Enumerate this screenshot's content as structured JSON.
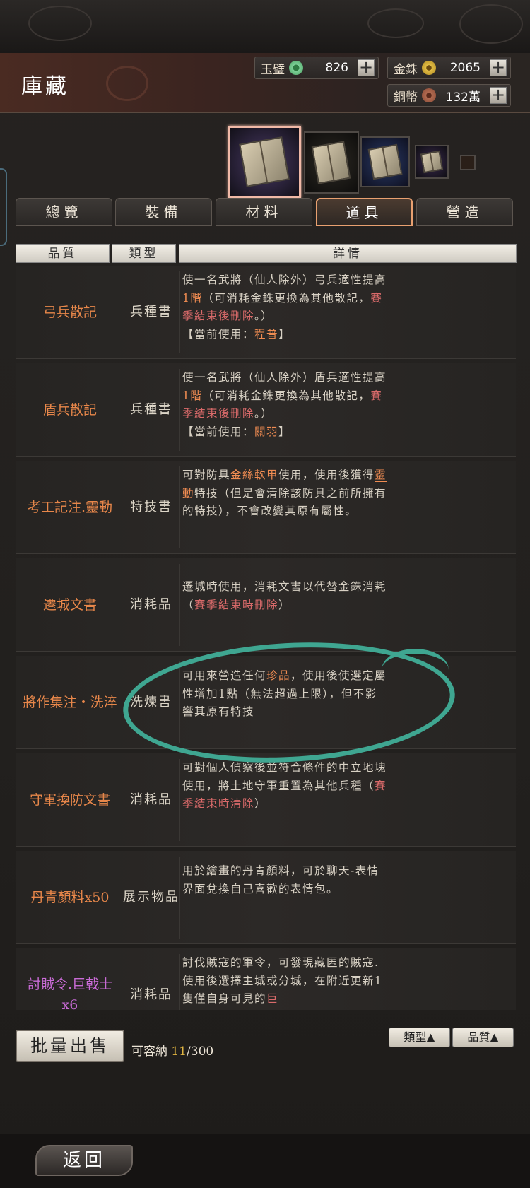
{
  "header": {
    "title": "庫藏"
  },
  "currency": [
    {
      "label": "玉璧",
      "value": "826",
      "color": "#6fc08a"
    },
    {
      "label": "金銖",
      "value": "2065",
      "color": "#d9b43c"
    },
    {
      "label": "銅幣",
      "value": "132萬",
      "color": "#a8654a"
    }
  ],
  "tabs": [
    "總覽",
    "裝備",
    "材料",
    "道具",
    "營造"
  ],
  "active_tab": "道具",
  "columns": [
    "品質",
    "類型",
    "詳情"
  ],
  "items": [
    {
      "name": "弓兵散記",
      "type": "兵種書",
      "d1": "使一名武將（仙人除外）弓兵適性提高",
      "d1b": "1階",
      "d1c": "（可消耗金銖更換為其他散記，",
      "d1d": "賽季結束後刪除",
      "d1e": "。）",
      "d2": "【當前使用：",
      "d2b": "程普",
      "d2c": "】"
    },
    {
      "name": "盾兵散記",
      "type": "兵種書",
      "d1": "使一名武將（仙人除外）盾兵適性提高",
      "d1b": "1階",
      "d1c": "（可消耗金銖更換為其他散記，",
      "d1d": "賽季結束後刪除",
      "d1e": "。）",
      "d2": "【當前使用：",
      "d2b": "關羽",
      "d2c": "】"
    },
    {
      "name": "考工記注.靈動",
      "type": "特技書",
      "d1": "可對防具",
      "d1b": "金絲軟甲",
      "d1c": "使用，使用後獲得",
      "d1d": "靈動",
      "d1e": "特技（但是會清除該防具之前所擁有的特技），不會改變其原有屬性。"
    },
    {
      "name": "遷城文書",
      "type": "消耗品",
      "d1": "遷城時使用，消耗文書以代替金銖消耗（",
      "d1b": "賽季結束時刪除",
      "d1c": "）"
    },
    {
      "name": "將作集注・洗淬",
      "type": "洗煉書",
      "d1": "可用來營造任何",
      "d1b": "珍品",
      "d1c": "，使用後使選定屬性增加1點（無法超過上限），但不影響其原有特技"
    },
    {
      "name": "守軍換防文書",
      "type": "消耗品",
      "d1": "可對個人偵察後並符合條件的中立地塊使用，將土地守軍重置為其他兵種（",
      "d1b": "賽季結束時清除",
      "d1c": "）"
    },
    {
      "name": "丹青顏料x50",
      "type": "展示物品",
      "d1": "用於繪畫的丹青顏料，可於聊天-表情界面兌換自己喜歡的表情包。"
    },
    {
      "name": "討賊令.巨戟士x6",
      "type": "消耗品",
      "d1": "討伐賊寇的軍令，可發現藏匿的賊寇.使用後選擇主城或分城，在附近更新1隻僅自身可見的",
      "d1b": "巨"
    }
  ],
  "footer": {
    "bulk_sell": "批量出售",
    "capacity_label": "可容納",
    "capacity_count": "11",
    "capacity_total": "/300",
    "sort_type": "類型▲",
    "sort_quality": "品質▲",
    "back": "返回"
  }
}
